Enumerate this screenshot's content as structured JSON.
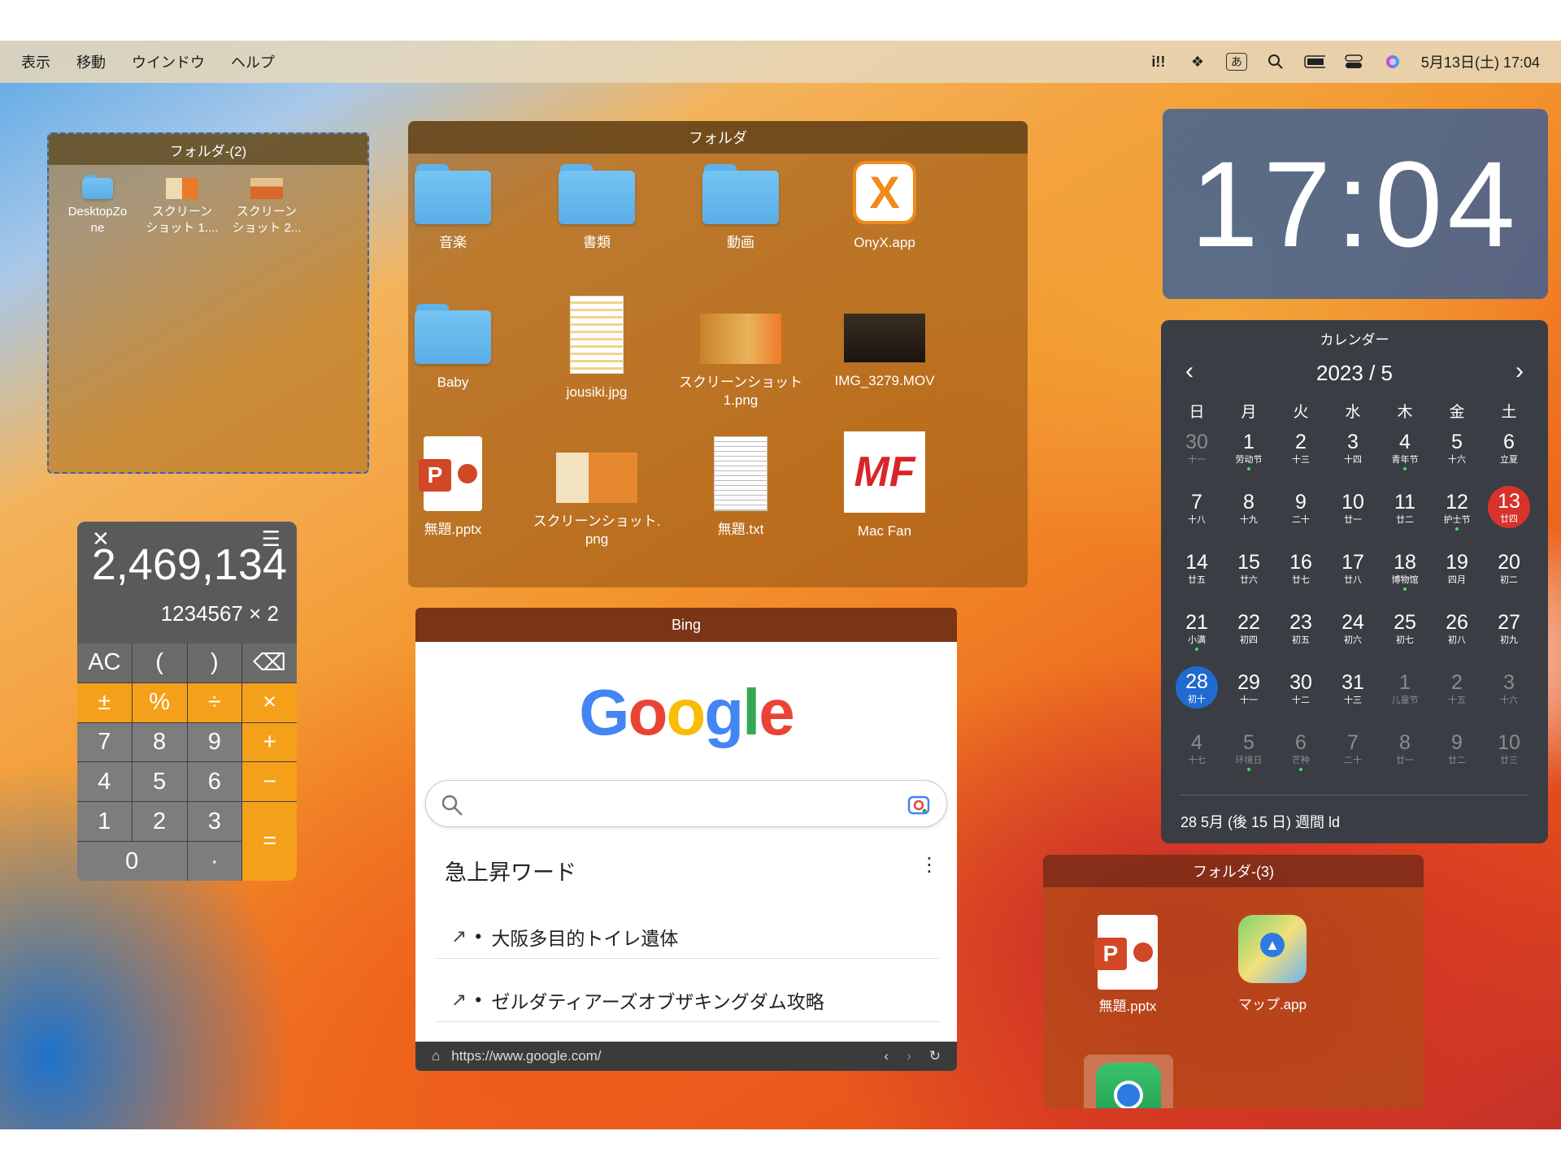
{
  "menubar": {
    "items": [
      "表示",
      "移動",
      "ウインドウ",
      "ヘルプ"
    ],
    "ime": "あ",
    "datetime": "5月13日(土)  17:04"
  },
  "folder2": {
    "title": "フォルダ-(2)",
    "items": [
      {
        "label": "DesktopZo\nne"
      },
      {
        "label": "スクリーン\nショット 1...."
      },
      {
        "label": "スクリーン\nショット 2..."
      }
    ]
  },
  "folder": {
    "title": "フォルダ",
    "items": [
      {
        "label": "音楽",
        "kind": "folder"
      },
      {
        "label": "書類",
        "kind": "folder"
      },
      {
        "label": "動画",
        "kind": "folder"
      },
      {
        "label": "OnyX.app",
        "kind": "onyx"
      },
      {
        "label": "Baby",
        "kind": "folder"
      },
      {
        "label": "jousiki.jpg",
        "kind": "doc"
      },
      {
        "label": "スクリーンショット\n1.png",
        "kind": "shot"
      },
      {
        "label": "IMG_3279.MOV",
        "kind": "mov"
      },
      {
        "label": "無題.pptx",
        "kind": "pptx"
      },
      {
        "label": "スクリーンショット.\npng",
        "kind": "shot2"
      },
      {
        "label": "無題.txt",
        "kind": "txt"
      },
      {
        "label": "Mac Fan",
        "kind": "mf"
      }
    ]
  },
  "clock": {
    "time": "17:04"
  },
  "calculator": {
    "display": "2,469,134",
    "expression": "1234567 × 2",
    "keys": [
      "AC",
      "(",
      ")",
      "⌫",
      "±",
      "%",
      "÷",
      "×",
      "7",
      "8",
      "9",
      "+",
      "4",
      "5",
      "6",
      "−",
      "1",
      "2",
      "3",
      "=",
      "0",
      "·"
    ]
  },
  "calendar": {
    "title": "カレンダー",
    "month": "2023 / 5",
    "weekdays": [
      "日",
      "月",
      "火",
      "水",
      "木",
      "金",
      "土"
    ],
    "weeks": [
      [
        [
          "30",
          "十一"
        ],
        [
          "1",
          "劳动节"
        ],
        [
          "2",
          "十三"
        ],
        [
          "3",
          "十四"
        ],
        [
          "4",
          "青年节"
        ],
        [
          "5",
          "十六"
        ],
        [
          "6",
          "立夏"
        ]
      ],
      [
        [
          "7",
          "十八"
        ],
        [
          "8",
          "十九"
        ],
        [
          "9",
          "二十"
        ],
        [
          "10",
          "廿一"
        ],
        [
          "11",
          "廿二"
        ],
        [
          "12",
          "护士节"
        ],
        [
          "13",
          "廿四"
        ]
      ],
      [
        [
          "14",
          "廿五"
        ],
        [
          "15",
          "廿六"
        ],
        [
          "16",
          "廿七"
        ],
        [
          "17",
          "廿八"
        ],
        [
          "18",
          "博物馆"
        ],
        [
          "19",
          "四月"
        ],
        [
          "20",
          "初二"
        ]
      ],
      [
        [
          "21",
          "小满"
        ],
        [
          "22",
          "初四"
        ],
        [
          "23",
          "初五"
        ],
        [
          "24",
          "初六"
        ],
        [
          "25",
          "初七"
        ],
        [
          "26",
          "初八"
        ],
        [
          "27",
          "初九"
        ]
      ],
      [
        [
          "28",
          "初十"
        ],
        [
          "29",
          "十一"
        ],
        [
          "30",
          "十二"
        ],
        [
          "31",
          "十三"
        ],
        [
          "1",
          "儿童节"
        ],
        [
          "2",
          "十五"
        ],
        [
          "3",
          "十六"
        ]
      ],
      [
        [
          "4",
          "十七"
        ],
        [
          "5",
          "环境日"
        ],
        [
          "6",
          "芒种"
        ],
        [
          "7",
          "二十"
        ],
        [
          "8",
          "廿一"
        ],
        [
          "9",
          "廿二"
        ],
        [
          "10",
          "廿三"
        ]
      ]
    ],
    "dotted": [
      "0-1",
      "0-4",
      "1-5",
      "2-4",
      "3-0",
      "5-1",
      "5-2"
    ],
    "dimmed": [
      "0-0",
      "4-4",
      "4-5",
      "4-6",
      "5-0",
      "5-1",
      "5-2",
      "5-3",
      "5-4",
      "5-5",
      "5-6"
    ],
    "today": "1-6",
    "selected": "4-0",
    "footer": "28 5月  (後 15 日) 週間 ld",
    "today_color": "#d7322c",
    "selected_color": "#1f6bd0"
  },
  "bing": {
    "title": "Bing",
    "logo": "Google",
    "trending_title": "急上昇ワード",
    "trends": [
      "大阪多目的トイレ遺体",
      "ゼルダティアーズオブザキングダム攻略"
    ],
    "url": "https://www.google.com/"
  },
  "folder3": {
    "title": "フォルダ-(3)",
    "items": [
      {
        "label": "無題.pptx"
      },
      {
        "label": "マップ.app"
      }
    ]
  }
}
